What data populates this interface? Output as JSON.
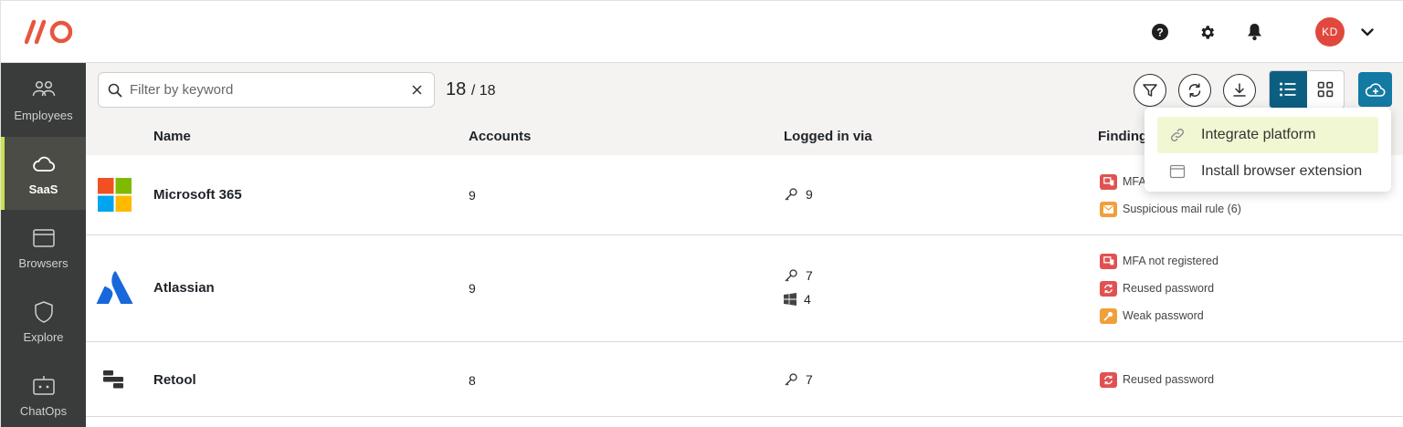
{
  "header": {
    "logo": "//O",
    "help_icon": "help-icon",
    "settings_icon": "gear-icon",
    "notifications_icon": "bell-icon",
    "avatar_initials": "KD",
    "avatar_color": "#e0483e",
    "accent_color": "#e8553f"
  },
  "sidebar": {
    "items": [
      {
        "label": "Employees",
        "icon": "people-icon",
        "active": false
      },
      {
        "label": "SaaS",
        "icon": "cloud-icon",
        "active": true
      },
      {
        "label": "Browsers",
        "icon": "browser-window-icon",
        "active": false
      },
      {
        "label": "Explore",
        "icon": "shield-icon",
        "active": false
      },
      {
        "label": "ChatOps",
        "icon": "chat-bot-icon",
        "active": false
      }
    ],
    "active_indicator_color": "#c8e34f"
  },
  "toolbar": {
    "search_placeholder": "Filter by keyword",
    "search_value": "",
    "count_shown": "18",
    "count_total": "/ 18",
    "view_active": "list",
    "primary_color": "#127aa3"
  },
  "table": {
    "columns": [
      "Name",
      "Accounts",
      "Logged in via",
      "Findings"
    ],
    "rows": [
      {
        "name": "Microsoft 365",
        "logo": "microsoft-logo",
        "accounts": "9",
        "logins": [
          {
            "type": "key-icon",
            "count": "9"
          }
        ],
        "findings": [
          {
            "label": "MFA not registered",
            "icon": "device-icon",
            "color": "#e05252"
          },
          {
            "label": "Suspicious mail rule (6)",
            "icon": "mail-icon",
            "color": "#f0a03a"
          }
        ]
      },
      {
        "name": "Atlassian",
        "logo": "atlassian-logo",
        "accounts": "9",
        "logins": [
          {
            "type": "key-icon",
            "count": "7"
          },
          {
            "type": "windows-icon",
            "count": "4"
          }
        ],
        "findings": [
          {
            "label": "MFA not registered",
            "icon": "device-icon",
            "color": "#e05252"
          },
          {
            "label": "Reused password",
            "icon": "refresh-icon",
            "color": "#e05252"
          },
          {
            "label": "Weak password",
            "icon": "key-icon",
            "color": "#f0a03a"
          }
        ]
      },
      {
        "name": "Retool",
        "logo": "retool-logo",
        "accounts": "8",
        "logins": [
          {
            "type": "key-icon",
            "count": "7"
          }
        ],
        "findings": [
          {
            "label": "Reused password",
            "icon": "refresh-icon",
            "color": "#e05252"
          }
        ]
      }
    ]
  },
  "dropdown": {
    "items": [
      {
        "label": "Integrate platform",
        "icon": "link-icon",
        "highlighted": true
      },
      {
        "label": "Install browser extension",
        "icon": "browser-window-icon",
        "highlighted": false
      }
    ]
  }
}
